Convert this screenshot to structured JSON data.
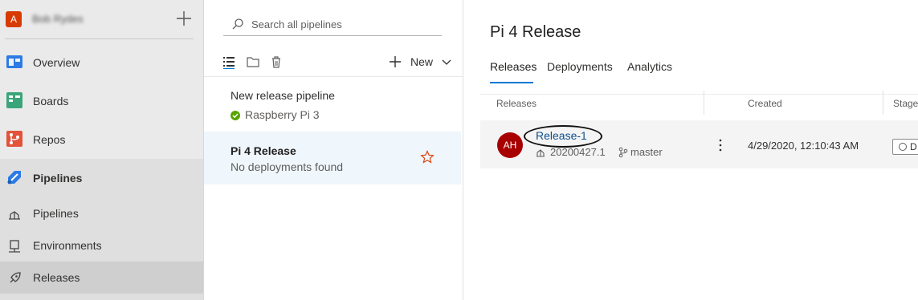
{
  "org": {
    "avatar_letter": "A",
    "name": "Bob Rydes"
  },
  "nav": {
    "items": [
      {
        "label": "Overview"
      },
      {
        "label": "Boards"
      },
      {
        "label": "Repos"
      },
      {
        "label": "Pipelines"
      }
    ],
    "sub_items": [
      {
        "label": "Pipelines"
      },
      {
        "label": "Environments"
      },
      {
        "label": "Releases"
      }
    ]
  },
  "middle": {
    "search_placeholder": "Search all pipelines",
    "new_label": "New",
    "pipelines": [
      {
        "name": "New release pipeline",
        "status": "Raspberry Pi 3"
      },
      {
        "name": "Pi 4 Release",
        "status": "No deployments found"
      }
    ]
  },
  "main": {
    "title": "Pi 4 Release",
    "tabs": [
      {
        "label": "Releases"
      },
      {
        "label": "Deployments"
      },
      {
        "label": "Analytics"
      }
    ],
    "columns": {
      "releases": "Releases",
      "created": "Created",
      "stages": "Stages"
    },
    "row": {
      "avatar_initials": "AH",
      "release_name": "Release-1",
      "build_number": "20200427.1",
      "branch": "master",
      "created": "4/29/2020, 12:10:43 AM",
      "stage_initial": "D"
    }
  },
  "colors": {
    "accent": "#0078d4",
    "success": "#57a300",
    "avatar": "#a80000",
    "org": "#d83b01"
  }
}
